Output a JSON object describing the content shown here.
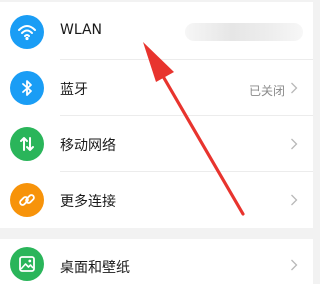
{
  "settings": {
    "items": [
      {
        "label": "WLAN",
        "status": "",
        "icon": "wifi-icon",
        "color": "#1a9df5"
      },
      {
        "label": "蓝牙",
        "status": "已关闭",
        "icon": "bluetooth-icon",
        "color": "#1a9df5"
      },
      {
        "label": "移动网络",
        "status": "",
        "icon": "mobile-data-icon",
        "color": "#2ab55a"
      },
      {
        "label": "更多连接",
        "status": "",
        "icon": "link-icon",
        "color": "#f7930a"
      },
      {
        "label": "桌面和壁纸",
        "status": "",
        "icon": "wallpaper-icon",
        "color": "#2ab55a"
      }
    ]
  },
  "annotation": {
    "arrow_color": "#e8342e"
  }
}
